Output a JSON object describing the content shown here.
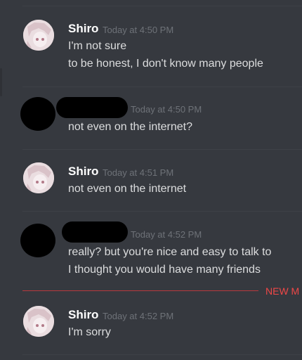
{
  "messages": [
    {
      "author": "Shiro",
      "time": "Today at 4:50 PM",
      "lines": [
        "I'm not sure",
        "to be honest, I don't know many people"
      ]
    },
    {
      "author": "",
      "time": "Today at 4:50 PM",
      "lines": [
        "not even on the internet?"
      ]
    },
    {
      "author": "Shiro",
      "time": "Today at 4:51 PM",
      "lines": [
        "not even on the internet"
      ]
    },
    {
      "author": "",
      "time": "Today at 4:52 PM",
      "lines": [
        "really? but you're nice and easy to talk to",
        "I thought you would have many friends"
      ]
    },
    {
      "author": "Shiro",
      "time": "Today at 4:52 PM",
      "lines": [
        "I'm sorry"
      ]
    }
  ],
  "new_messages_label": "NEW M",
  "colors": {
    "background": "#36393f",
    "author": "#ffffff",
    "text": "#dcddde",
    "timestamp": "#6e7278",
    "new_marker": "#f04747"
  }
}
